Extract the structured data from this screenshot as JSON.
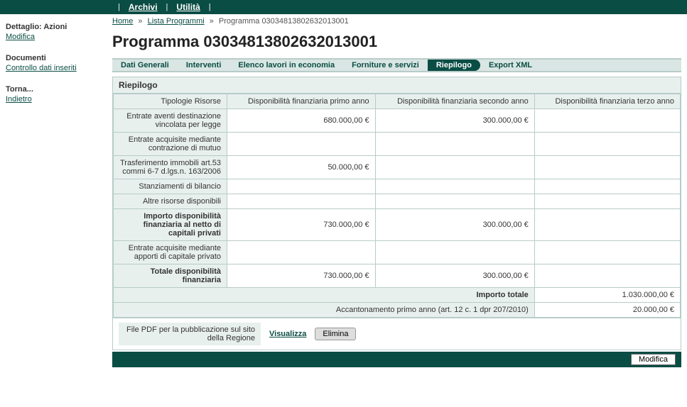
{
  "topMenu": {
    "archivi": "Archivi",
    "utilita": "Utilità"
  },
  "breadcrumb": {
    "home": "Home",
    "lista": "Lista Programmi",
    "current": "Programma 03034813802632013001"
  },
  "pageTitle": "Programma 03034813802632013001",
  "sidebar": {
    "azioni": {
      "title": "Dettaglio: Azioni",
      "modifica": "Modifica"
    },
    "documenti": {
      "title": "Documenti",
      "controllo": "Controllo dati inseriti"
    },
    "torna": {
      "title": "Torna...",
      "indietro": "Indietro"
    }
  },
  "tabs": {
    "dati": "Dati Generali",
    "interventi": "Interventi",
    "elenco": "Elenco lavori in economia",
    "forniture": "Forniture e servizi",
    "riepilogo": "Riepilogo",
    "export": "Export XML"
  },
  "panelTitle": "Riepilogo",
  "headers": {
    "tipologie": "Tipologie Risorse",
    "anno1": "Disponibilità finanziaria primo anno",
    "anno2": "Disponibilità finanziaria secondo anno",
    "anno3": "Disponibilità finanziaria terzo anno"
  },
  "rows": {
    "r1": {
      "label": "Entrate aventi destinazione vincolata per legge",
      "v1": "680.000,00 €",
      "v2": "300.000,00 €",
      "v3": ""
    },
    "r2": {
      "label": "Entrate acquisite mediante contrazione di mutuo",
      "v1": "",
      "v2": "",
      "v3": ""
    },
    "r3": {
      "label": "Trasferimento immobili art.53 commi 6-7 d.lgs.n. 163/2006",
      "v1": "50.000,00 €",
      "v2": "",
      "v3": ""
    },
    "r4": {
      "label": "Stanziamenti di bilancio",
      "v1": "",
      "v2": "",
      "v3": ""
    },
    "r5": {
      "label": "Altre risorse disponibili",
      "v1": "",
      "v2": "",
      "v3": ""
    },
    "r6": {
      "label": "Importo disponibilità finanziaria al netto di capitali privati",
      "v1": "730.000,00 €",
      "v2": "300.000,00 €",
      "v3": "",
      "bold": true
    },
    "r7": {
      "label": "Entrate acquisite mediante apporti di capitale privato",
      "v1": "",
      "v2": "",
      "v3": ""
    },
    "r8": {
      "label": "Totale disponibilità finanziaria",
      "v1": "730.000,00 €",
      "v2": "300.000,00 €",
      "v3": "",
      "bold": true
    }
  },
  "footer": {
    "importoTotaleLabel": "Importo totale",
    "importoTotaleVal": "1.030.000,00 €",
    "accantonamentoLabel": "Accantonamento primo anno (art. 12 c. 1 dpr 207/2010)",
    "accantonamentoVal": "20.000,00 €"
  },
  "pdf": {
    "label": "File PDF per la pubblicazione sul sito della Regione",
    "visualizza": "Visualizza",
    "elimina": "Elimina"
  },
  "bottom": {
    "modifica": "Modifica"
  }
}
